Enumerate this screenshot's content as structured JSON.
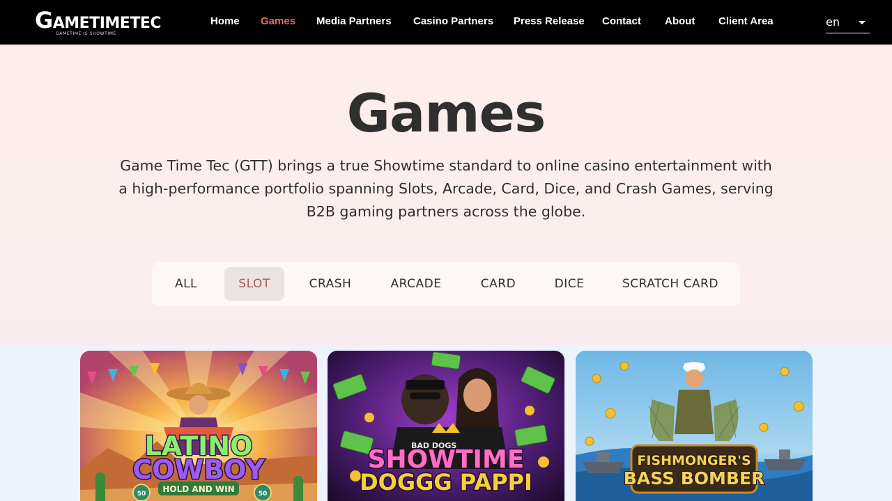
{
  "brand": {
    "logo_first": "G",
    "logo_rest": "AMETIMETEC",
    "tagline": "GAMETIME IS SHOWTIME"
  },
  "nav": {
    "items": [
      {
        "label": "Home"
      },
      {
        "label": "Games",
        "active": true
      },
      {
        "label": "Media Partners"
      },
      {
        "label": "Casino Partners"
      },
      {
        "label": "Press Release"
      },
      {
        "label": "Contact"
      },
      {
        "label": "About"
      },
      {
        "label": "Client Area"
      }
    ],
    "language": "en"
  },
  "hero": {
    "title": "Games",
    "description": "Game Time Tec (GTT) brings a true Showtime standard to online casino entertainment with a high-performance portfolio spanning Slots, Arcade, Card, Dice, and Crash Games, serving B2B gaming partners across the globe."
  },
  "filters": {
    "items": [
      {
        "label": "ALL"
      },
      {
        "label": "SLOT",
        "active": true
      },
      {
        "label": "CRASH"
      },
      {
        "label": "ARCADE"
      },
      {
        "label": "CARD"
      },
      {
        "label": "DICE"
      },
      {
        "label": "SCRATCH CARD"
      }
    ]
  },
  "games": [
    {
      "line1": "LATINO",
      "line2": "COWBOY",
      "line3": "HOLD AND WIN",
      "badge": "50"
    },
    {
      "line0": "BAD DOGS",
      "line1": "SHOWTIME",
      "line2": "DOGGG PAPPI"
    },
    {
      "line1": "FISHMONGER'S",
      "line2": "BASS BOMBER"
    }
  ],
  "colors": {
    "nav_bg": "#000000",
    "nav_active": "#e86b6b",
    "filter_active_text": "#a85a5a",
    "filter_active_bg": "#ebe3e2"
  }
}
